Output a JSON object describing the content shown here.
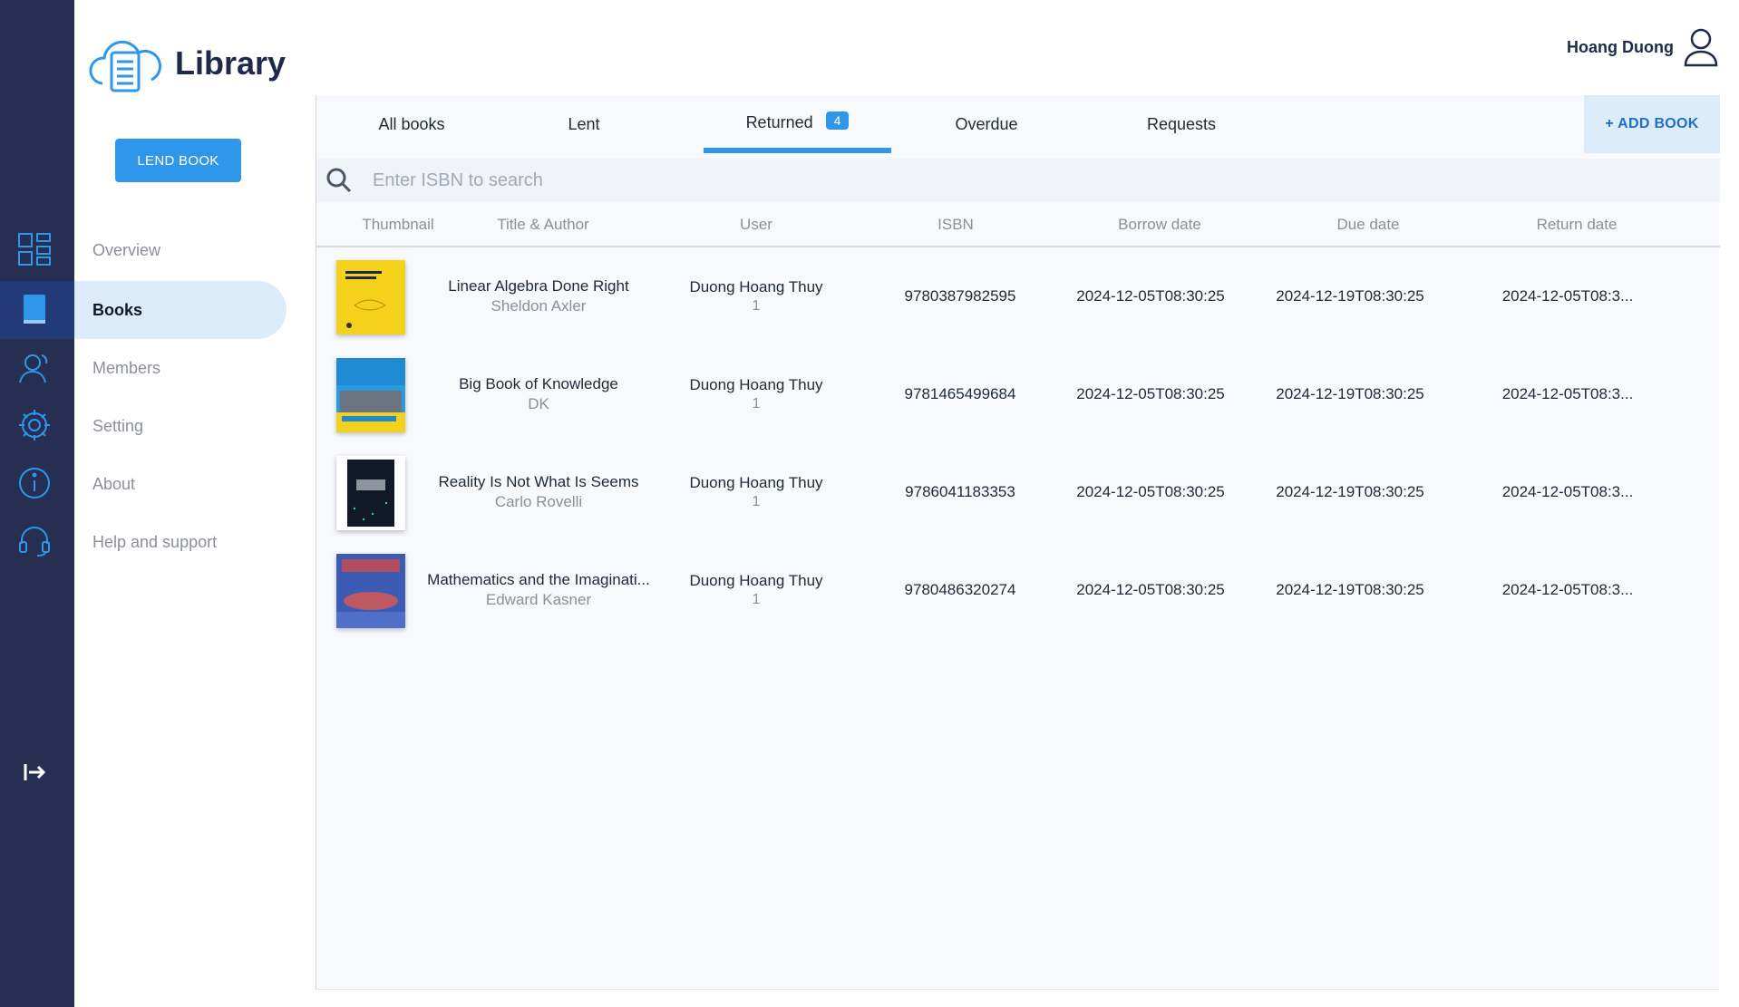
{
  "app": {
    "title": "Library"
  },
  "user": {
    "name": "Hoang Duong"
  },
  "sidebar": {
    "lend_button": "LEND BOOK",
    "items": [
      {
        "label": "Overview"
      },
      {
        "label": "Books"
      },
      {
        "label": "Members"
      },
      {
        "label": "Setting"
      },
      {
        "label": "About"
      },
      {
        "label": "Help and support"
      }
    ]
  },
  "tabs": [
    {
      "label": "All books"
    },
    {
      "label": "Lent"
    },
    {
      "label": "Returned",
      "badge": "4"
    },
    {
      "label": "Overdue"
    },
    {
      "label": "Requests"
    }
  ],
  "add_book_label": "+ ADD BOOK",
  "search": {
    "placeholder": "Enter ISBN to search"
  },
  "table": {
    "columns": [
      "Thumbnail",
      "Title & Author",
      "User",
      "ISBN",
      "Borrow date",
      "Due date",
      "Return date"
    ],
    "rows": [
      {
        "title": "Linear Algebra Done Right",
        "author": "Sheldon Axler",
        "user": "Duong Hoang Thuy",
        "user_id": "1",
        "isbn": "9780387982595",
        "borrow": "2024-12-05T08:30:25",
        "due": "2024-12-19T08:30:25",
        "ret": "2024-12-05T08:3..."
      },
      {
        "title": "Big Book of Knowledge",
        "author": "DK",
        "user": "Duong Hoang Thuy",
        "user_id": "1",
        "isbn": "9781465499684",
        "borrow": "2024-12-05T08:30:25",
        "due": "2024-12-19T08:30:25",
        "ret": "2024-12-05T08:3..."
      },
      {
        "title": "Reality Is Not What Is Seems",
        "author": "Carlo Rovelli",
        "user": "Duong Hoang Thuy",
        "user_id": "1",
        "isbn": "9786041183353",
        "borrow": "2024-12-05T08:30:25",
        "due": "2024-12-19T08:30:25",
        "ret": "2024-12-05T08:3..."
      },
      {
        "title": "Mathematics and the Imaginati...",
        "author": "Edward Kasner",
        "user": "Duong Hoang Thuy",
        "user_id": "1",
        "isbn": "9780486320274",
        "borrow": "2024-12-05T08:30:25",
        "due": "2024-12-19T08:30:25",
        "ret": "2024-12-05T08:3..."
      }
    ]
  },
  "colors": {
    "rail": "#262f52",
    "accent": "#2e97ec",
    "active_bg": "#dcecfb"
  }
}
